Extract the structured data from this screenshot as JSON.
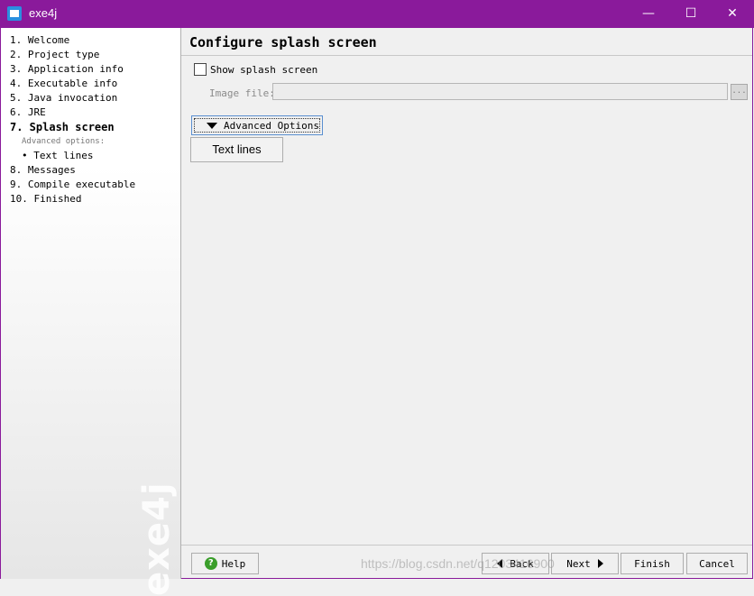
{
  "window": {
    "title": "exe4j",
    "minimize": "—",
    "maximize": "☐",
    "close": "✕"
  },
  "sidebar": {
    "steps": [
      {
        "label": "1. Welcome"
      },
      {
        "label": "2. Project type"
      },
      {
        "label": "3. Application info"
      },
      {
        "label": "4. Executable info"
      },
      {
        "label": "5. Java invocation"
      },
      {
        "label": "6. JRE"
      },
      {
        "label": "7. Splash screen"
      },
      {
        "label": "Advanced options:"
      },
      {
        "label": "• Text lines"
      },
      {
        "label": "8. Messages"
      },
      {
        "label": "9. Compile executable"
      },
      {
        "label": "10. Finished"
      }
    ],
    "watermark": "exe4j"
  },
  "main": {
    "title": "Configure splash screen",
    "show_splash_label": "Show splash screen",
    "show_splash_checked": false,
    "image_file_label": "Image file:",
    "image_file_value": "",
    "browse_label": "...",
    "advanced_options_label": "Advanced Options",
    "text_lines_label": "Text lines"
  },
  "footer": {
    "help_label": "Help",
    "back_label": "Back",
    "next_label": "Next",
    "finish_label": "Finish",
    "cancel_label": "Cancel",
    "overlay_text": "https://blog.csdn.net/q1203416900"
  },
  "colors": {
    "titlebar": "#8a1a9b",
    "help_icon": "#3a9e2a",
    "focus_border": "#5a8fd0"
  }
}
